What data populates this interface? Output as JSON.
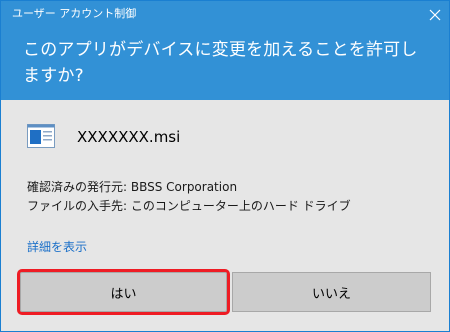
{
  "window": {
    "title": "ユーザー アカウント制御",
    "close_icon": "close-icon",
    "accent_color": "#3291d6"
  },
  "header": {
    "question": "このアプリがデバイスに変更を加えることを許可しますか?"
  },
  "file": {
    "icon": "msi-file-icon",
    "name": "XXXXXXX.msi"
  },
  "info": {
    "publisher": "確認済みの発行元: BBSS Corporation",
    "origin": "ファイルの入手先: このコンピューター上のハード ドライブ"
  },
  "details_link": "詳細を表示",
  "buttons": {
    "yes": "はい",
    "no": "いいえ"
  },
  "highlight_color": "#ee1c24"
}
